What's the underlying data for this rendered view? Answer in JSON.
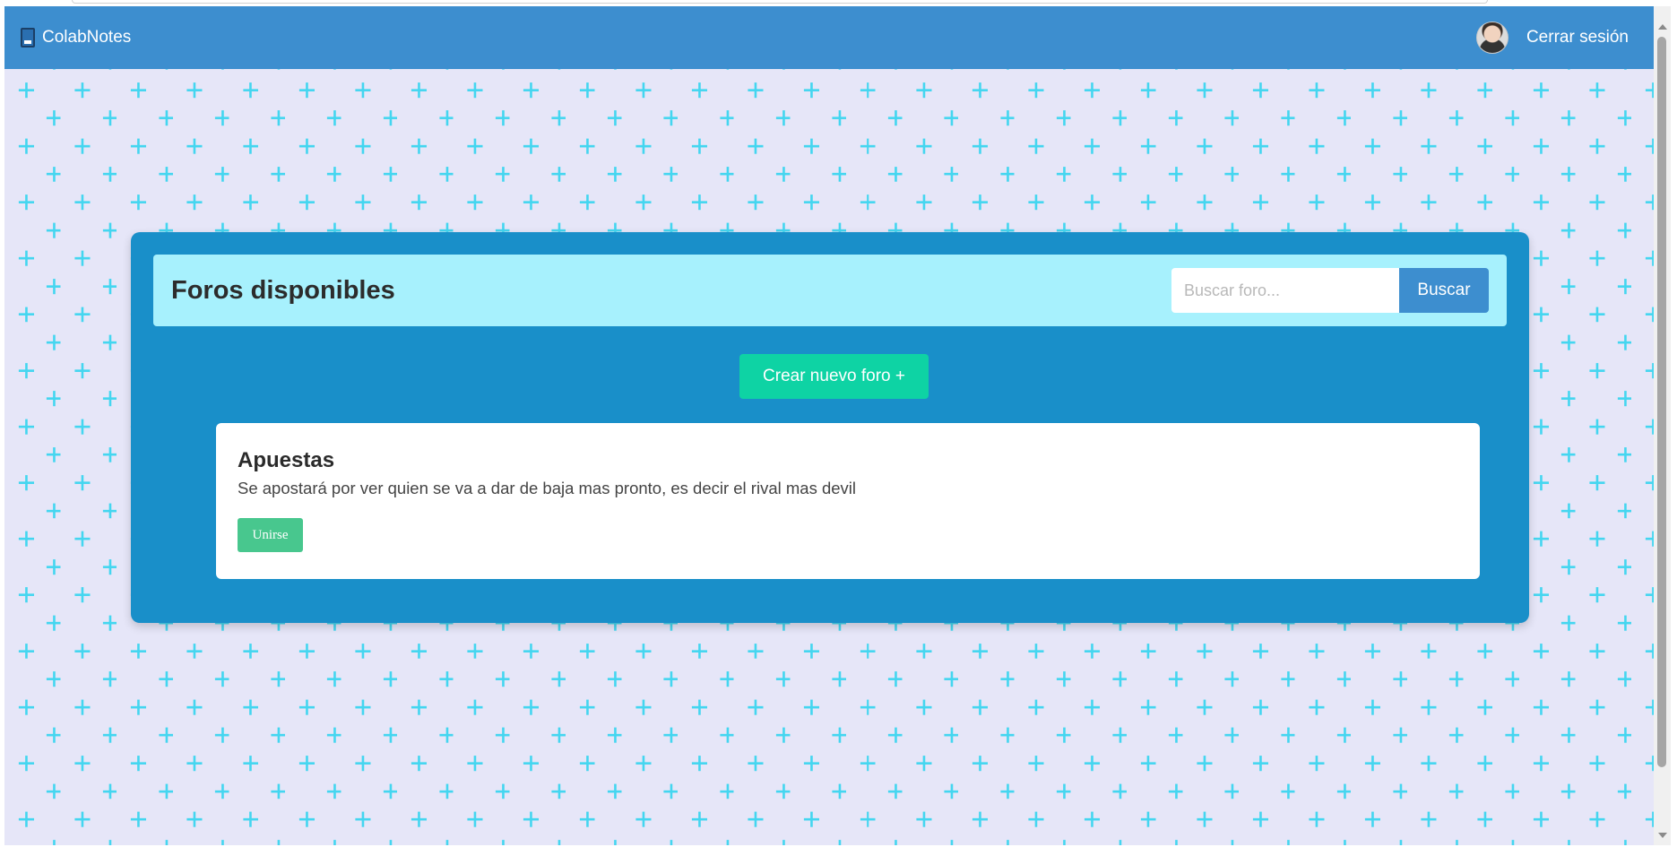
{
  "navbar": {
    "brand_label": "ColabNotes",
    "logout_label": "Cerrar sesión"
  },
  "panel": {
    "title": "Foros disponibles",
    "search": {
      "placeholder": "Buscar foro...",
      "value": "",
      "button_label": "Buscar"
    },
    "create_button_label": "Crear nuevo foro +"
  },
  "forums": [
    {
      "title": "Apuestas",
      "description": "Se apostará por ver quien se va a dar de baja mas pronto, es decir el rival mas devil",
      "join_label": "Unirse"
    }
  ],
  "colors": {
    "navbar": "#3d8ecf",
    "panel": "#198fc9",
    "panel_header": "#a7f1fd",
    "create_button": "#0ed3a4",
    "join_button": "#48c78e",
    "pattern_plus": "#44d6f0",
    "page_background": "#e6e6f8"
  },
  "icons": {
    "brand": "book-icon",
    "user": "avatar"
  }
}
